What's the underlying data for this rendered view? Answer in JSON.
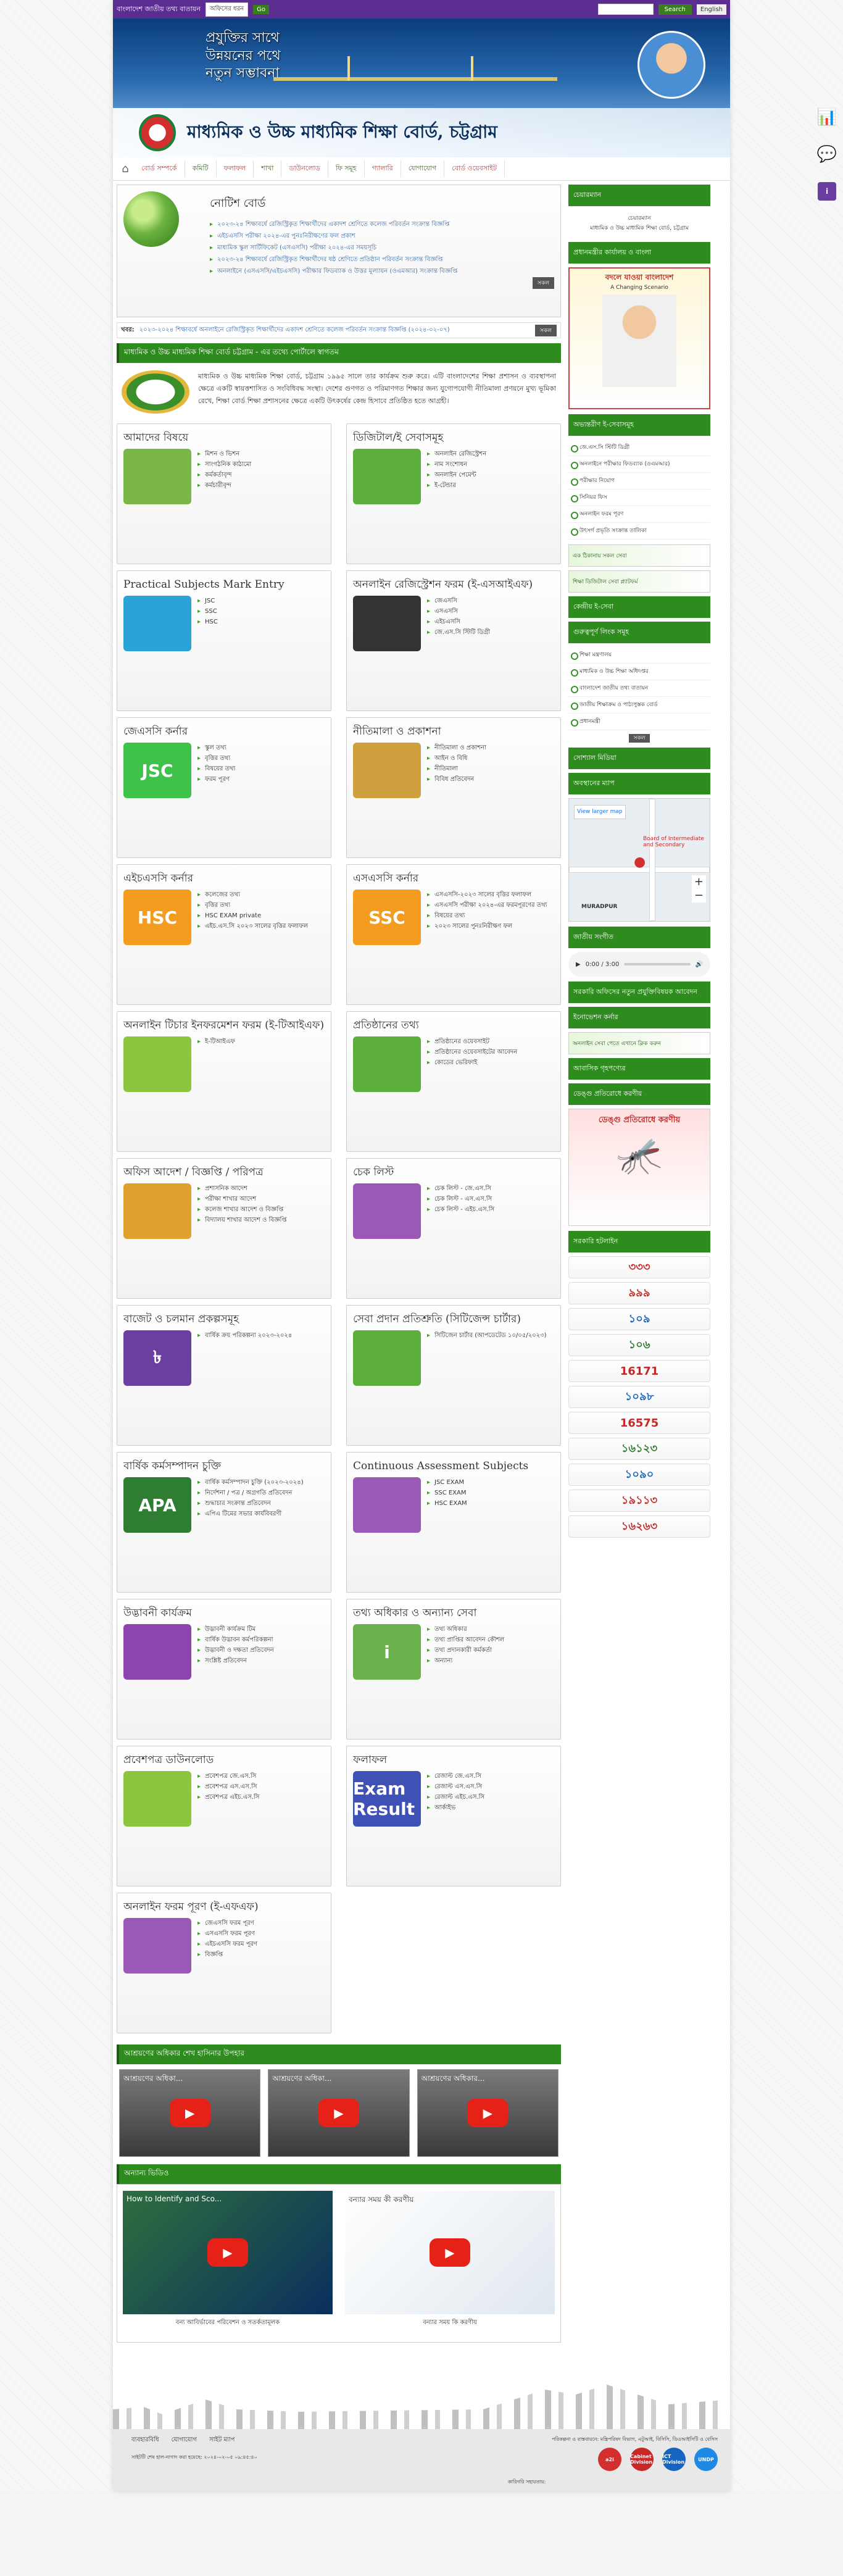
{
  "topbar": {
    "portal_label": "বাংলাদেশ জাতীয় তথ্য বাতায়ন",
    "select_value": "অফিসের ধরন",
    "go": "Go",
    "search_btn": "Search",
    "english": "English"
  },
  "banner": {
    "slogan1": "প্রযুক্তির সাথে",
    "slogan2": "উন্নয়নের পথে",
    "slogan3": "নতুন সম্ভাবনা",
    "board_name": "মাধ্যমিক ও উচ্চ মাধ্যমিক শিক্ষা বোর্ড, চট্টগ্রাম"
  },
  "menu": [
    "বোর্ড সম্পর্কে",
    "কমিটি",
    "ফলাফল",
    "শাখা",
    "ডাউনলোড",
    "ফি সমূহ",
    "গ্যালারি",
    "যোগাযোগ",
    "বোর্ড ওয়েবসাইট"
  ],
  "notice": {
    "title": "নোটিশ বোর্ড",
    "items": [
      "২০২৩-২৪ শিক্ষাবর্ষে রেজিস্ট্রিকৃত শিক্ষার্থীদের একাদশ শ্রেণিতে কলেজ পরিবর্তন সংক্রান্ত বিজ্ঞপ্তি",
      "এইচএসসি পরীক্ষা ২০২৪-এর পুনঃনিরীক্ষণের ফল প্রকাশ",
      "মাধ্যমিক স্কুল সার্টিফিকেট (এসএসসি) পরীক্ষা ২০২৪-এর সময়সূচি",
      "২০২৩-২৪ শিক্ষাবর্ষে রেজিস্ট্রিকৃত শিক্ষার্থীদের ষষ্ঠ শ্রেণিতে প্রতিষ্ঠান পরিবর্তন সংক্রান্ত বিজ্ঞপ্তি",
      "অনলাইনে (এসএসসি/এইচএসসি) পরীক্ষার ফিডব্যাক ও উত্তর মূল্যায়ন (ওএমআর) সংক্রান্ত বিজ্ঞপ্তি"
    ],
    "more": "সকল"
  },
  "ticker": {
    "label": "খবর:",
    "text": "২০২৩-২০২৪ শিক্ষাবর্ষে অনলাইনে রেজিস্ট্রিকৃত শিক্ষার্থীদের একাদশ শ্রেণিতে কলেজ পরিবর্তন সংক্রান্ত বিজ্ঞপ্তি (২০২৪-০২-০৭)",
    "btn": "সকল"
  },
  "welcome": {
    "title": "মাধ্যমিক ও উচ্চ মাধ্যমিক শিক্ষা বোর্ড চট্টগ্রাম - এর তথ্যে পোর্টালে স্বাগতম",
    "text": "মাধ্যমিক ও উচ্চ মাধ্যমিক শিক্ষা বোর্ড, চট্টগ্রাম ১৯৯৫ সালে তার কার্যক্রম শুরু করে। এটি বাংলাদেশের শিক্ষা প্রশাসন ও ব্যবস্থাপনা ক্ষেত্রে একটি স্বায়ত্তশাসিত ও সংবিধিবদ্ধ সংস্থা। দেশের গুণগত ও পরিমাণগত শিক্ষার জন্য যুগোপযোগী নীতিমালা প্রণয়নে মুখ্য ভূমিকা রেখে, শিক্ষা বোর্ড শিক্ষা প্রশাসনের ক্ষেত্রে একটি উৎকর্ষের কেন্দ্র হিসাবে প্রতিষ্ঠিত হতে আগ্রহী।"
  },
  "tiles": [
    {
      "title": "আমাদের বিষয়ে",
      "items": [
        "মিশন ও ভিশন",
        "সাংগঠনিক কাঠামো",
        "কর্মকর্তাবৃন্দ",
        "কর্মচারীবৃন্দ"
      ],
      "icon_text": "",
      "icon": "people-icon",
      "color": "#7ab648"
    },
    {
      "title": "ডিজিটাল/ই সেবাসমূহ",
      "items": [
        "অনলাইন রেজিস্ট্রেশন",
        "নাম সংশোধন",
        "অনলাইন পেমেন্ট",
        "ই-টেন্ডার"
      ],
      "icon_text": "",
      "icon": "globe-icon",
      "color": "#5cae3d"
    },
    {
      "title": "Practical Subjects Mark Entry",
      "items": [
        "JSC",
        "SSC",
        "HSC"
      ],
      "icon_text": "",
      "icon": "checklist-icon",
      "color": "#29a3d8"
    },
    {
      "title": "অনলাইন রেজিস্ট্রেশন ফরম (ই-এসআইএফ)",
      "items": [
        "জেএসসি",
        "এসএসসি",
        "এইচএসসি",
        "জে.এস.সি স্টিটি ডিগ্রী"
      ],
      "icon_text": "",
      "icon": "graduation-cap-icon",
      "color": "#333333"
    },
    {
      "title": "জেএসসি কর্নার",
      "items": [
        "স্কুল তথ্য",
        "বৃত্তির তথ্য",
        "বিষয়ের তথ্য",
        "ফরম পূরণ"
      ],
      "icon_text": "JSC",
      "icon": "jsc-icon",
      "color": "#3fc24a"
    },
    {
      "title": "নীতিমালা ও প্রকাশনা",
      "items": [
        "নীতিমালা ও প্রকাশনা",
        "আইন ও বিধি",
        "নীতিমালা",
        "বিবিধ প্রতিবেদন"
      ],
      "icon_text": "",
      "icon": "gavel-icon",
      "color": "#d0a040"
    },
    {
      "title": "এইচএসসি কর্নার",
      "items": [
        "কলেজের তথ্য",
        "বৃত্তির তথ্য",
        "HSC EXAM private",
        "এইচ.এস.সি ২০২৩ সালের বৃত্তির ফলাফল"
      ],
      "icon_text": "HSC",
      "icon": "hsc-icon",
      "color": "#f39c1f"
    },
    {
      "title": "এসএসসি কর্নার",
      "items": [
        "এসএসসি-২০২৩ সালের বৃত্তির ফলাফল",
        "এসএসসি পরীক্ষা ২০২৪-এর ফরমপূরণের তথ্য",
        "বিষয়ের তথ্য",
        "২০২৩ সালের পুনঃনিরীক্ষণ ফল"
      ],
      "icon_text": "SSC",
      "icon": "ssc-icon",
      "color": "#f39c1f"
    },
    {
      "title": "অনলাইন টিচার ইনফরমেশন ফরম (ই-টিআইএফ)",
      "items": [
        "ই-টিআইএফ"
      ],
      "icon_text": "",
      "icon": "teacher-icon",
      "color": "#8cc63f"
    },
    {
      "title": "প্রতিষ্ঠানের তথ্য",
      "items": [
        "প্রতিষ্ঠানের ওয়েবসাইট",
        "প্রতিষ্ঠানের ওয়েবসাইটের আবেদন",
        "কোডের ভেরিফাই"
      ],
      "icon_text": "",
      "icon": "globe-icon",
      "color": "#5cae3d"
    },
    {
      "title": "অফিস আদেশ / বিজ্ঞপ্তি / পরিপত্র",
      "items": [
        "প্রশাসনিক আদেশ",
        "পরীক্ষা শাখার আদেশ",
        "কলেজ শাখার আদেশ ও বিজ্ঞপ্তি",
        "বিদ্যালয় শাখার আদেশ ও বিজ্ঞপ্তি"
      ],
      "icon_text": "",
      "icon": "document-icon",
      "color": "#e0a030"
    },
    {
      "title": "চেক লিস্ট",
      "items": [
        "চেক লিস্ট - জে.এস.সি",
        "চেক লিস্ট - এস.এস.সি",
        "চেক লিস্ট - এইচ.এস.সি"
      ],
      "icon_text": "",
      "icon": "checklist-pen-icon",
      "color": "#9b59b6"
    },
    {
      "title": "বাজেট ও চলমান প্রকল্পসমূহ",
      "items": [
        "বার্ষিক ক্রয় পরিকল্পনা ২০২৩-২০২৪"
      ],
      "icon_text": "৳",
      "icon": "budget-icon",
      "color": "#6b3fa0"
    },
    {
      "title": "সেবা প্রদান প্রতিশ্রুতি (সিটিজেন্স চার্টার)",
      "items": [
        "সিটিজেন চার্টার (আপডেটেড ১০/০৫/২০২৩)"
      ],
      "icon_text": "",
      "icon": "meeting-icon",
      "color": "#5cae3d"
    },
    {
      "title": "বার্ষিক কর্মসম্পাদন চুক্তি",
      "items": [
        "বার্ষিক কর্মসম্পাদন চুক্তি (২০২৩-২০২৪)",
        "নির্দেশনা / পত্র / অগ্রগতি প্রতিবেদন",
        "শুদ্ধাচার সংক্রান্ত প্রতিবেদন",
        "এপিএ টিমের সভার কার্যবিবরণী"
      ],
      "icon_text": "APA",
      "icon": "apa-icon",
      "color": "#2e7d32"
    },
    {
      "title": "Continuous Assessment Subjects",
      "items": [
        "JSC EXAM",
        "SSC EXAM",
        "HSC EXAM"
      ],
      "icon_text": "",
      "icon": "assessment-icon",
      "color": "#9b59b6"
    },
    {
      "title": "উদ্ভাবনী কার্যক্রম",
      "items": [
        "উদ্ভাবনী কার্যক্রম টিম",
        "বার্ষিক উদ্ভাবন কর্মপরিকল্পনা",
        "উদ্ভাবনী ও দক্ষতা প্রতিবেদন",
        "সংশ্লিষ্ট প্রতিবেদন"
      ],
      "icon_text": "",
      "icon": "lightbulb-icon",
      "color": "#8e44ad"
    },
    {
      "title": "তথ্য অধিকার ও অন্যান্য সেবা",
      "items": [
        "তথ্য অধিকার",
        "তথ্য প্রাপ্তির আবেদন কৌশল",
        "তথ্য প্রদানকারী কর্মকর্তা",
        "অন্যান্য"
      ],
      "icon_text": "i",
      "icon": "info-icon",
      "color": "#6ab04c"
    },
    {
      "title": "প্রবেশপত্র ডাউনলোড",
      "items": [
        "প্রবেশপত্র জে.এস.সি",
        "প্রবেশপত্র এস.এস.সি",
        "প্রবেশপত্র এইচ.এস.সি"
      ],
      "icon_text": "",
      "icon": "admit-card-icon",
      "color": "#8cc63f"
    },
    {
      "title": "ফলাফল",
      "items": [
        "রেজাল্ট জে.এস.সি",
        "রেজাল্ট এস.এস.সি",
        "রেজাল্ট এইচ.এস.সি",
        "আর্কাইভ"
      ],
      "icon_text": "Exam Result",
      "icon": "exam-result-icon",
      "color": "#3f51b5"
    },
    {
      "title": "অনলাইন ফরম পূরণ (ই-এফএফ)",
      "items": [
        "জেএসসি ফরম পূরণ",
        "এসএসসি ফরম পূরণ",
        "এইচএসসি ফরম পূরণ",
        "বিজ্ঞপ্তি"
      ],
      "icon_text": "",
      "icon": "form-pen-icon",
      "color": "#9b59b6"
    }
  ],
  "videos": {
    "title": "আশ্রয়ণের অধিকার শেখ হাসিনার উপহার",
    "items": [
      "আশ্রয়ণের অধিকা...",
      "আশ্রয়ণের অধিকা...",
      "আশ্রয়ণের অধিকার..."
    ]
  },
  "bigvideos": {
    "title": "অন্যান্য ভিডিও",
    "items": [
      {
        "title": "How to Identify and Sco...",
        "caption": "বন্য আবির্ভাবের পরিবেশন ও সতর্কতামূলক"
      },
      {
        "title": "বন্যার সময় কী করণীয়",
        "caption": "বন্যার সময় কি করণীয়"
      }
    ]
  },
  "side": {
    "chair_title": "চেয়ারম্যান",
    "chair_text": "চেয়ারম্যান",
    "chair_org": "মাধ্যমিক ও উচ্চ মাধ্যমিক শিক্ষা বোর্ড, চট্টগ্রাম",
    "pm_title": "প্রধানমন্ত্রীর কার্যালয় ও বাংলা",
    "poster_title": "বদলে যাওয়া বাংলাদেশ",
    "poster_sub": "A Changing Scenario",
    "services_title": "অভ্যন্তরীণ ই-সেবাসমূহ",
    "services": [
      "জে.এস.সি স্টিটি ডিগ্রী",
      "অনলাইনে পরীক্ষার ফিডব্যাক (ওএমআর)",
      "পরীক্ষার নিয়োগ",
      "সিনিয়র ফিস",
      "অনলাইন ফরম পূরণ",
      "উৎসর্গ প্রভৃতি সংক্রান্ত তালিকা"
    ],
    "banner_a": "এক ঠিকানায় সকল সেবা",
    "banner_b": "শিক্ষা ডিজিটাল সেবা প্ল্যাটফর্ম",
    "central_title": "কেন্দ্রীয় ই-সেবা",
    "links_title": "গুরুত্বপূর্ণ লিংক সমূহ",
    "links": [
      "শিক্ষা মন্ত্রণালয়",
      "মাধ্যমিক ও উচ্চ শিক্ষা অধিদপ্তর",
      "বাংলাদেশ জাতীয় তথ্য বাতায়ন",
      "জাতীয় শিক্ষাক্রম ও পাঠ্যপুস্তক বোর্ড",
      "প্রধানমন্ত্রী"
    ],
    "links_more": "সকল",
    "social_title": "সোশ্যাল মিডিয়া",
    "map_title": "অবস্থানের ম্যাপ",
    "map_link": "View larger map",
    "map_place": "Board of Intermediate and Secondary",
    "map_area": "MURADPUR",
    "audio_title": "জাতীয় সংগীত",
    "audio_time": "0:00 / 3:00",
    "innov_title": "সরকারি অফিসের নতুন প্রযুক্তিবিষয়ক আবেদন",
    "egov_title": "ইনোভেশন কর্নার",
    "egov_item": "অনলাইন সেবা পেতে এখানে ক্লিক করুন",
    "ad_title": "আবাসিক গৃহপণ্যের",
    "dengue_title": "ডেঙ্গু প্রতিরোধে করণীয়",
    "dengue_text": "ডেঙ্গু প্রতিরোধে করণীয়",
    "hotline_title": "সরকারি হটলাইন",
    "hotlines": [
      "৩৩৩",
      "৯৯৯",
      "১০৯",
      "১০৬",
      "16171",
      "১০৯৮",
      "16575",
      "১৬১২৩",
      "১০৯০",
      "১৯১১৩",
      "১৬২৬৩"
    ]
  },
  "footer": {
    "links": [
      "ব্যবহারবিধি",
      "যোগাযোগ",
      "সাইট ম্যাপ"
    ],
    "planning": "পরিকল্পনা ও বাস্তবায়নে: মন্ত্রিপরিষদ বিভাগ, এটুআই, বিসিসি, ডিওআইসিটি ও বেসিস",
    "updated": "সাইটটি শেষ হাল-নাগাদ করা হয়েছে: ২০২৪-০২-০৫ ০৯:৪৫:৪০",
    "tech": "কারিগরি সহায়তায়:",
    "logos": [
      "a2i",
      "Cabinet Division",
      "ICT Division",
      "UNDP"
    ]
  }
}
